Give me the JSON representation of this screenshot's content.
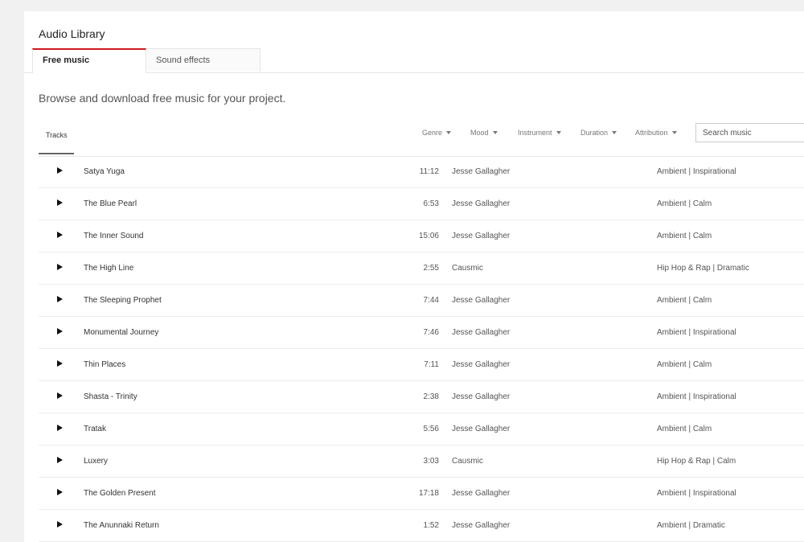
{
  "page": {
    "title": "Audio Library",
    "subtitle": "Browse and download free music for your project."
  },
  "tabs": [
    {
      "label": "Free music",
      "active": true
    },
    {
      "label": "Sound effects",
      "active": false
    }
  ],
  "filters": {
    "tracks_label": "Tracks",
    "genre": "Genre",
    "mood": "Mood",
    "instrument": "Instrument",
    "duration": "Duration",
    "attribution": "Attribution",
    "search_placeholder": "Search music"
  },
  "tracks": [
    {
      "title": "Satya Yuga",
      "duration": "11:12",
      "artist": "Jesse Gallagher",
      "genre_mood": "Ambient | Inspirational"
    },
    {
      "title": "The Blue Pearl",
      "duration": "6:53",
      "artist": "Jesse Gallagher",
      "genre_mood": "Ambient | Calm"
    },
    {
      "title": "The Inner Sound",
      "duration": "15:06",
      "artist": "Jesse Gallagher",
      "genre_mood": "Ambient | Calm"
    },
    {
      "title": "The High Line",
      "duration": "2:55",
      "artist": "Causmic",
      "genre_mood": "Hip Hop & Rap | Dramatic"
    },
    {
      "title": "The Sleeping Prophet",
      "duration": "7:44",
      "artist": "Jesse Gallagher",
      "genre_mood": "Ambient | Calm"
    },
    {
      "title": "Monumental Journey",
      "duration": "7:46",
      "artist": "Jesse Gallagher",
      "genre_mood": "Ambient | Inspirational"
    },
    {
      "title": "Thin Places",
      "duration": "7:11",
      "artist": "Jesse Gallagher",
      "genre_mood": "Ambient | Calm"
    },
    {
      "title": "Shasta - Trinity",
      "duration": "2:38",
      "artist": "Jesse Gallagher",
      "genre_mood": "Ambient | Inspirational"
    },
    {
      "title": "Tratak",
      "duration": "5:56",
      "artist": "Jesse Gallagher",
      "genre_mood": "Ambient | Calm"
    },
    {
      "title": "Luxery",
      "duration": "3:03",
      "artist": "Causmic",
      "genre_mood": "Hip Hop & Rap | Calm"
    },
    {
      "title": "The Golden Present",
      "duration": "17:18",
      "artist": "Jesse Gallagher",
      "genre_mood": "Ambient | Inspirational"
    },
    {
      "title": "The Anunnaki Return",
      "duration": "1:52",
      "artist": "Jesse Gallagher",
      "genre_mood": "Ambient | Dramatic"
    }
  ],
  "colors": {
    "accent": "#cc181e",
    "background": "#f1f1f1",
    "card": "#ffffff"
  },
  "icons": {
    "play": "play-icon",
    "dropdown": "chevron-down-icon"
  }
}
